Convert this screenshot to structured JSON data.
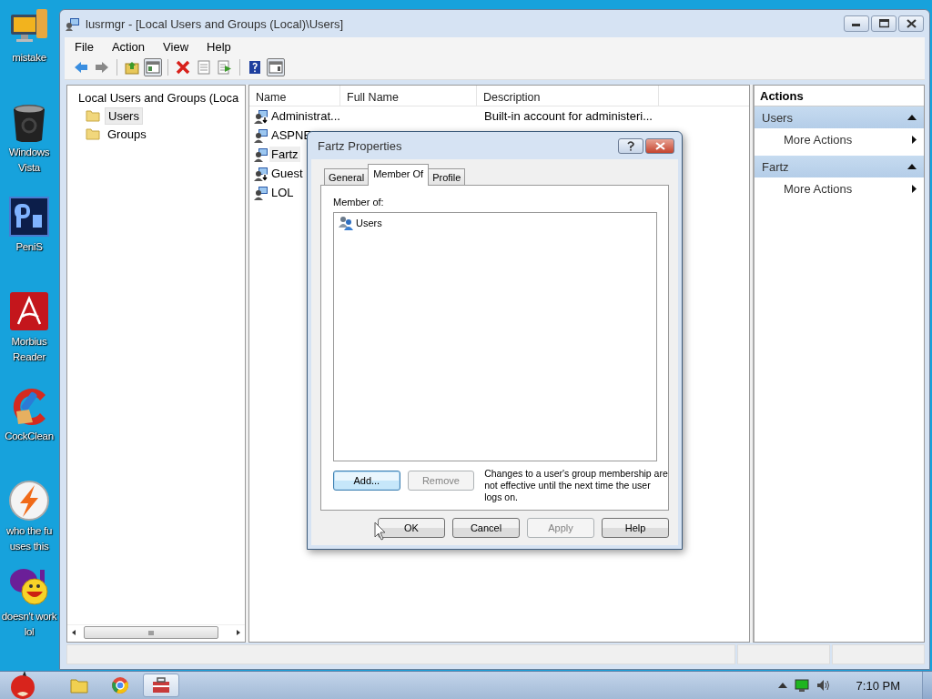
{
  "desktop_icons": [
    {
      "label": "mistake",
      "kind": "computer"
    },
    {
      "label": "Windows Vista",
      "kind": "bin"
    },
    {
      "label": "PeniS",
      "kind": "ps"
    },
    {
      "label": "Morbius Reader",
      "kind": "pdf"
    },
    {
      "label": "CockClean",
      "kind": "cleaner"
    },
    {
      "label": "who the fu uses this",
      "kind": "bolt"
    },
    {
      "label": "doesn't work lol",
      "kind": "messenger"
    }
  ],
  "window": {
    "title": "lusrmgr - [Local Users and Groups (Local)\\Users]",
    "menu": [
      "File",
      "Action",
      "View",
      "Help"
    ],
    "toolbar": [
      {
        "kind": "back",
        "pressed": false
      },
      {
        "kind": "forward",
        "pressed": false
      },
      {
        "kind": "sep"
      },
      {
        "kind": "up",
        "pressed": false
      },
      {
        "kind": "tree",
        "pressed": true
      },
      {
        "kind": "sep"
      },
      {
        "kind": "delete",
        "pressed": false
      },
      {
        "kind": "properties",
        "pressed": false
      },
      {
        "kind": "export",
        "pressed": false
      },
      {
        "kind": "sep"
      },
      {
        "kind": "help",
        "pressed": false
      },
      {
        "kind": "pane",
        "pressed": true
      }
    ],
    "tree": {
      "label": "Local Users and Groups (Loca",
      "children": [
        {
          "label": "Users",
          "selected": true
        },
        {
          "label": "Groups",
          "selected": false
        }
      ]
    },
    "list": {
      "columns": [
        "Name",
        "Full Name",
        "Description"
      ],
      "rows": [
        {
          "name": "Administrat...",
          "description": "Built-in account for administeri...",
          "disabled": true,
          "selected": false
        },
        {
          "name": "ASPNE",
          "disabled": false,
          "selected": false
        },
        {
          "name": "Fartz",
          "disabled": false,
          "selected": true
        },
        {
          "name": "Guest",
          "disabled": true,
          "selected": false
        },
        {
          "name": "LOL",
          "disabled": false,
          "selected": false
        }
      ]
    },
    "actions": {
      "title": "Actions",
      "sections": [
        {
          "title": "Users",
          "expanded": true,
          "items": [
            "More Actions"
          ]
        },
        {
          "title": "Fartz",
          "expanded": true,
          "items": [
            "More Actions"
          ]
        }
      ]
    }
  },
  "dialog": {
    "title": "Fartz Properties",
    "tabs": [
      {
        "label": "General",
        "selected": false
      },
      {
        "label": "Member Of",
        "selected": true
      },
      {
        "label": "Profile",
        "selected": false
      }
    ],
    "member_label": "Member of:",
    "members": [
      {
        "label": "Users",
        "selected": false
      }
    ],
    "list_buttons": [
      {
        "label": "Add...",
        "disabled": false,
        "default": true
      },
      {
        "label": "Remove",
        "disabled": true,
        "default": false
      }
    ],
    "note": "Changes to a user's group membership are not effective until the next time the user logs on.",
    "buttons": [
      {
        "label": "OK",
        "disabled": false
      },
      {
        "label": "Cancel",
        "disabled": false
      },
      {
        "label": "Apply",
        "disabled": true
      },
      {
        "label": "Help",
        "disabled": false
      }
    ]
  },
  "taskbar": {
    "buttons": [
      {
        "kind": "folder",
        "active": false
      },
      {
        "kind": "browser",
        "active": false
      },
      {
        "kind": "toolbox",
        "active": true
      }
    ],
    "clock": "7:10 PM"
  }
}
